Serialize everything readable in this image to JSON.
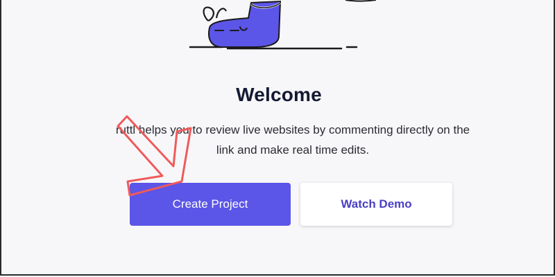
{
  "welcome": {
    "title": "Welcome",
    "description_line1": "ruttl helps you to review live websites by commenting directly on the",
    "description_line2": "link and make real time edits."
  },
  "actions": {
    "create_project_label": "Create Project",
    "watch_demo_label": "Watch Demo"
  },
  "colors": {
    "primary": "#5b55e8",
    "secondary_text": "#4a3fc4",
    "annotation_arrow": "#ef5a5a",
    "background": "#f7f7f9"
  },
  "icons": {
    "illustration": "sneaker-illustration",
    "annotation": "red-outline-arrow"
  }
}
